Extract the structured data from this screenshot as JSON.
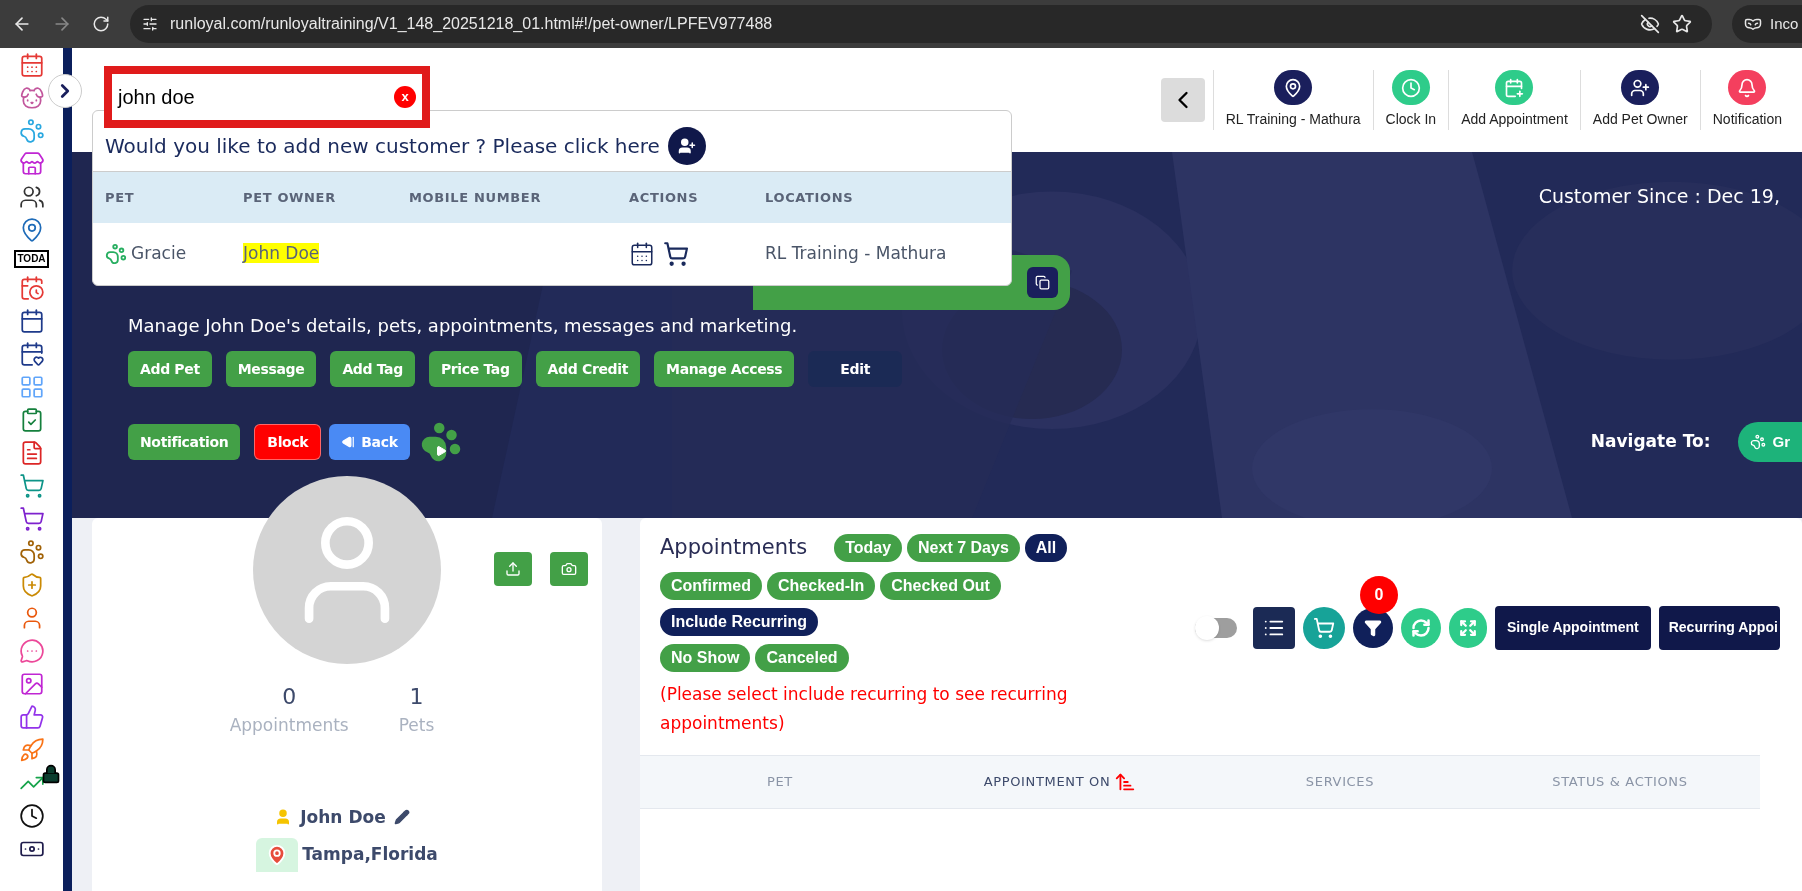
{
  "browser": {
    "url": "runloyal.com/runloyaltraining/V1_148_20251218_01.html#!/pet-owner/LPFEV977488",
    "profile_label": "Inco"
  },
  "sidebar": {
    "today_label": "TODA"
  },
  "search": {
    "value": "john doe",
    "clear_label": "x"
  },
  "dropdown": {
    "prompt": "Would you like to add new customer ? Please click here",
    "columns": [
      "PET",
      "PET OWNER",
      "MOBILE NUMBER",
      "ACTIONS",
      "LOCATIONS"
    ],
    "rows": [
      {
        "pet": "Gracie",
        "owner": "John Doe",
        "mobile": "",
        "location": "RL Training - Mathura",
        "highlighted": true
      }
    ]
  },
  "header_nav": [
    {
      "kind": "location",
      "label": "RL Training - Mathura"
    },
    {
      "kind": "clock",
      "label": "Clock In"
    },
    {
      "kind": "calendar",
      "label": "Add Appointment"
    },
    {
      "kind": "person",
      "label": "Add Pet Owner"
    },
    {
      "kind": "bell",
      "label": "Notification"
    }
  ],
  "hero": {
    "customer_since": "Customer Since : Dec 19,",
    "description": "Manage John Doe's details, pets, appointments, messages and marketing.",
    "actions": [
      {
        "label": "Add Pet",
        "kind": "green"
      },
      {
        "label": "Message",
        "kind": "green"
      },
      {
        "label": "Add Tag",
        "kind": "green"
      },
      {
        "label": "Price Tag",
        "kind": "green"
      },
      {
        "label": "Add Credit",
        "kind": "green"
      },
      {
        "label": "Manage Access",
        "kind": "green"
      },
      {
        "label": "Edit",
        "kind": "navy"
      }
    ],
    "actions_2": [
      {
        "label": "Notification",
        "kind": "green"
      },
      {
        "label": "Block",
        "kind": "red"
      },
      {
        "label": "Back",
        "kind": "blue"
      }
    ],
    "navigate_label": "Navigate To:",
    "navigate_button": "Gr"
  },
  "profile": {
    "stats": [
      {
        "value": "0",
        "label": "Appointments"
      },
      {
        "value": "1",
        "label": "Pets"
      }
    ],
    "name": "John Doe",
    "location": "Tampa,Florida"
  },
  "appointments": {
    "title": "Appointments",
    "filter_rows": [
      {
        "chips": [
          {
            "label": "Today",
            "selected": false
          },
          {
            "label": "Next 7 Days",
            "selected": false
          },
          {
            "label": "All",
            "selected": true
          }
        ]
      },
      {
        "chips": [
          {
            "label": "Confirmed",
            "selected": false
          },
          {
            "label": "Checked-In",
            "selected": false
          },
          {
            "label": "Checked Out",
            "selected": false
          }
        ]
      },
      {
        "chips": [
          {
            "label": "Include Recurring",
            "selected": true
          }
        ]
      },
      {
        "chips": [
          {
            "label": "No Show",
            "selected": false
          },
          {
            "label": "Canceled",
            "selected": false
          }
        ]
      }
    ],
    "note": "(Please select include recurring to see recurring appointments)",
    "toggle_on": false,
    "filter_count": "0",
    "buttons": [
      "Single Appointment",
      "Recurring Appoi"
    ],
    "columns": [
      {
        "label": "PET",
        "sorted": false
      },
      {
        "label": "APPOINTMENT ON",
        "sorted": true
      },
      {
        "label": "SERVICES",
        "sorted": false
      },
      {
        "label": "STATUS & ACTIONS",
        "sorted": false
      }
    ]
  }
}
